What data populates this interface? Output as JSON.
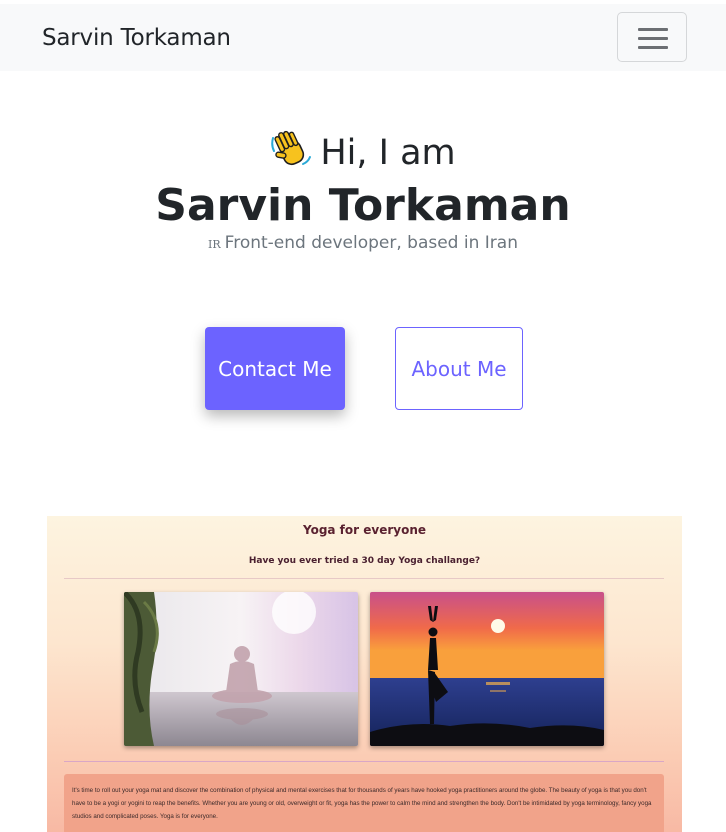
{
  "navbar": {
    "brand": "Sarvin Torkaman",
    "toggler_icon": "hamburger-icon"
  },
  "hero": {
    "wave_icon": "waving-hand-icon",
    "greeting": "Hi, I am",
    "name": "Sarvin Torkaman",
    "flag": "IR",
    "subtitle": "Front-end developer, based in Iran"
  },
  "buttons": {
    "contact_label": "Contact Me",
    "about_label": "About Me"
  },
  "colors": {
    "accent": "#6c63ff",
    "navbar_bg": "#f8f9fa",
    "text": "#212529",
    "muted": "#6c757d"
  },
  "project": {
    "title": "Yoga for everyone",
    "subtitle": "Have you ever tried a 30 day Yoga challange?",
    "paragraph": "It's time to roll out your yoga mat and discover the combination of physical and mental exercises that for thousands of years have hooked yoga practitioners around the globe. The beauty of yoga is that you don't have to be a yogi or yogini to reap the benefits. Whether you are young or old, overweight or fit, yoga has the power to calm the mind and strengthen the body. Don't be intimidated by yoga terminology, fancy yoga studios and complicated poses. Yoga is for everyone."
  }
}
